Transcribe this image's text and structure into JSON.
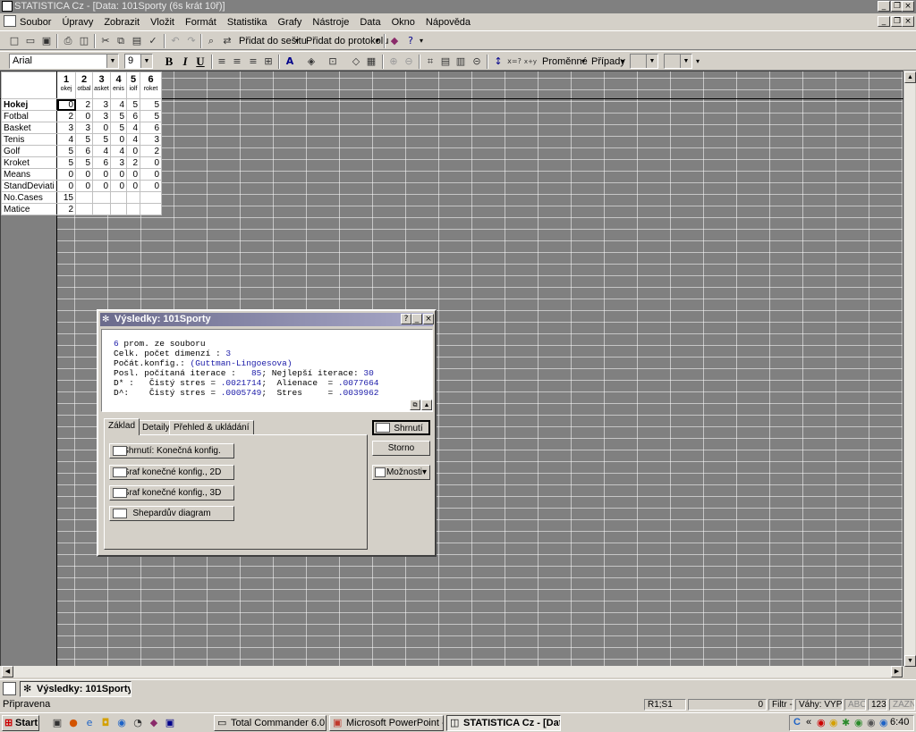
{
  "window": {
    "title": "STATISTICA Cz - [Data: 101Sporty (6s krát 10ř)]"
  },
  "menu": [
    "Soubor",
    "Úpravy",
    "Zobrazit",
    "Vložit",
    "Formát",
    "Statistika",
    "Grafy",
    "Nástroje",
    "Data",
    "Okno",
    "Nápověda"
  ],
  "toolbar": {
    "add_workbook": "Přidat do sešitu",
    "add_report": "Přidat do protokolu"
  },
  "format_bar": {
    "font": "Arial",
    "size": "9",
    "bold": "B",
    "italic": "I",
    "underline": "U",
    "variables": "Proměnné",
    "cases": "Případy"
  },
  "spreadsheet": {
    "columns": [
      {
        "num": "1",
        "sub": "okej"
      },
      {
        "num": "2",
        "sub": "otbal"
      },
      {
        "num": "3",
        "sub": "asket"
      },
      {
        "num": "4",
        "sub": "enis"
      },
      {
        "num": "5",
        "sub": "iolf"
      },
      {
        "num": "6",
        "sub": "roket"
      }
    ],
    "rows": [
      {
        "name": "Hokej",
        "cells": [
          "0",
          "2",
          "3",
          "4",
          "5",
          "5"
        ]
      },
      {
        "name": "Fotbal",
        "cells": [
          "2",
          "0",
          "3",
          "5",
          "6",
          "5"
        ]
      },
      {
        "name": "Basket",
        "cells": [
          "3",
          "3",
          "0",
          "5",
          "4",
          "6"
        ]
      },
      {
        "name": "Tenis",
        "cells": [
          "4",
          "5",
          "5",
          "0",
          "4",
          "3"
        ]
      },
      {
        "name": "Golf",
        "cells": [
          "5",
          "6",
          "4",
          "4",
          "0",
          "2"
        ]
      },
      {
        "name": "Kroket",
        "cells": [
          "5",
          "5",
          "6",
          "3",
          "2",
          "0"
        ]
      },
      {
        "name": "Means",
        "cells": [
          "0",
          "0",
          "0",
          "0",
          "0",
          "0"
        ]
      },
      {
        "name": "StandDeviati",
        "cells": [
          "0",
          "0",
          "0",
          "0",
          "0",
          "0"
        ]
      },
      {
        "name": "No.Cases",
        "cells": [
          "15",
          "",
          "",
          "",
          "",
          ""
        ]
      },
      {
        "name": "Matice",
        "cells": [
          "2",
          "",
          "",
          "",
          "",
          ""
        ]
      }
    ]
  },
  "dialog": {
    "title": "Výsledky: 101Sporty",
    "output": {
      "l1a": "6",
      "l1b": " prom. ze souboru",
      "l2a": "Celk. počet dimenzí : ",
      "l2b": "3",
      "l3a": "Počát.konfig.: ",
      "l3b": "(Guttman-Lingoesova)",
      "l4a": "Posl. počítaná iterace :   ",
      "l4b": "85",
      "l4c": "; Nejlepší iterace: ",
      "l4d": "30",
      "l5a": "D* :   Čistý stres = ",
      "l5b": ".0021714",
      "l5c": ";  Alienace  = ",
      "l5d": ".0077664",
      "l6a": "D^:    Čistý stres = ",
      "l6b": ".0005749",
      "l6c": ";  Stres     = ",
      "l6d": ".0039962"
    },
    "tabs": [
      "Základ",
      "Detaily",
      "Přehled & ukládání"
    ],
    "buttons": [
      "Shrnutí: Konečná konfig.",
      "Graf konečné konfig., 2D",
      "Graf konečné konfig., 3D",
      "Shepardův diagram"
    ],
    "side": {
      "summary": "Shrnutí",
      "cancel": "Storno",
      "options": "Možnosti"
    }
  },
  "mdi_task": "Výsledky: 101Sporty",
  "status": {
    "ready": "Připravena",
    "cell": "Ř1;S1",
    "zero": "0",
    "filter": "Filtr -",
    "weights": "Váhy: VYPN",
    "abc": "ABC",
    "num": "123",
    "zazn": "ZÁZN"
  },
  "taskbar": {
    "start": "Start",
    "items": [
      "Total Commander 6.0 - P...",
      "Microsoft PowerPoint - [...",
      "STATISTICA Cz - [Dat..."
    ],
    "time": "6:40"
  }
}
